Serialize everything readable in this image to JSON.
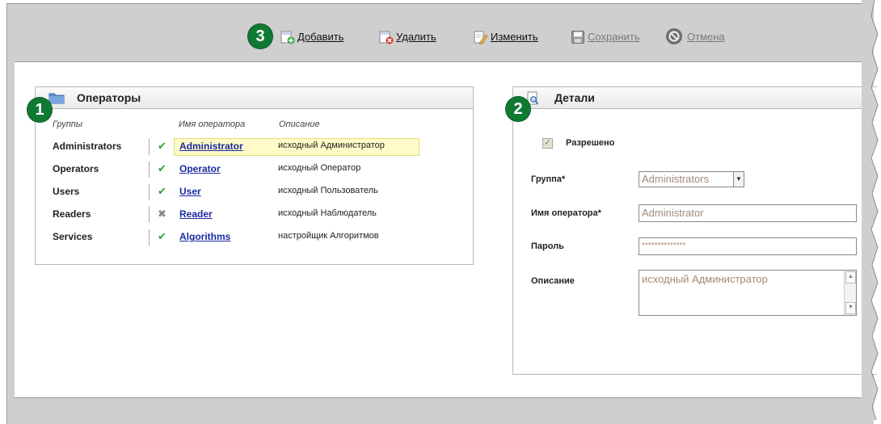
{
  "badges": {
    "operators": "1",
    "details": "2",
    "toolbar": "3"
  },
  "toolbar": {
    "add": {
      "label": "Добавить",
      "icon": "add-icon"
    },
    "delete": {
      "label": "Удалить",
      "icon": "delete-icon"
    },
    "edit": {
      "label": "Изменить",
      "icon": "edit-icon"
    },
    "save": {
      "label": "Сохранить",
      "icon": "save-icon"
    },
    "cancel": {
      "label": "Отмена",
      "icon": "cancel-icon"
    }
  },
  "operators": {
    "title": "Операторы",
    "columns": {
      "group": "Группы",
      "name": "Имя оператора",
      "description": "Описание"
    },
    "rows": [
      {
        "group": "Administrators",
        "status": "✔",
        "enabled": true,
        "name": "Administrator",
        "description": "исходный Администратор",
        "selected": true
      },
      {
        "group": "Operators",
        "status": "✔",
        "enabled": true,
        "name": "Operator",
        "description": "исходный Оператор",
        "selected": false
      },
      {
        "group": "Users",
        "status": "✔",
        "enabled": true,
        "name": "User",
        "description": "исходный Пользователь",
        "selected": false
      },
      {
        "group": "Readers",
        "status": "✖",
        "enabled": false,
        "name": "Reader",
        "description": "исходный Наблюдатель",
        "selected": false
      },
      {
        "group": "Services",
        "status": "✔",
        "enabled": true,
        "name": "Algorithms",
        "description": "настройщик Алгоритмов",
        "selected": false
      }
    ]
  },
  "details": {
    "title": "Детали",
    "allowed_label": "Разрешено",
    "allowed_checked": true,
    "group_label": "Группа*",
    "group_value": "Administrators",
    "name_label": "Имя оператора*",
    "name_value": "Administrator",
    "password_label": "Пароль",
    "password_value": "**************",
    "description_label": "Описание",
    "description_value": "исходный Администратор"
  },
  "colors": {
    "badge": "#0f7a34",
    "link": "#1a2aa0",
    "selection": "#fffbc8",
    "check": "#2aa23a"
  }
}
